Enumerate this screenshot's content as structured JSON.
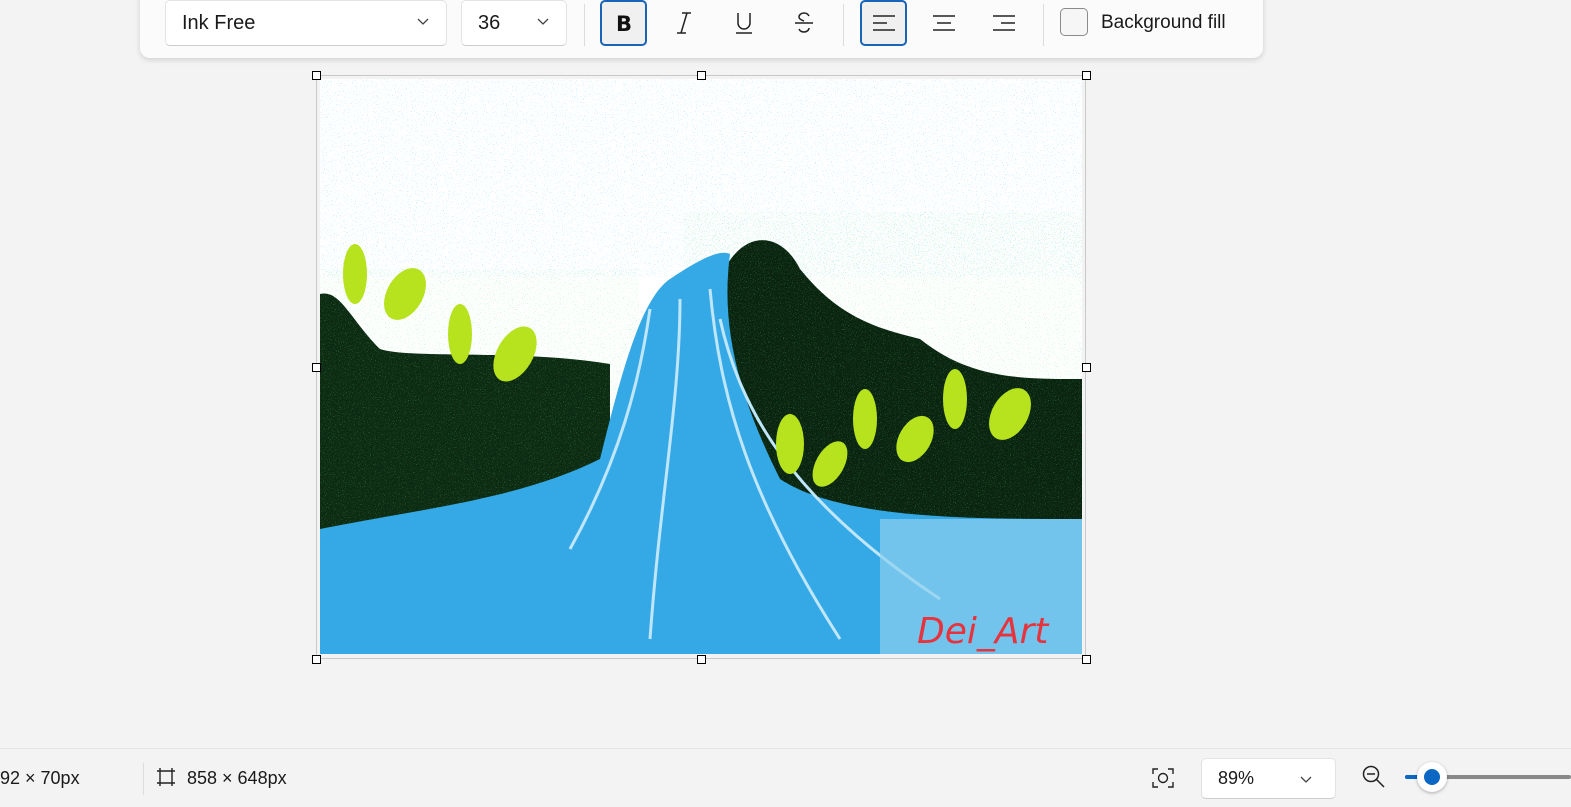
{
  "toolbar": {
    "font_family": "Ink Free",
    "font_size": "36",
    "bold_selected": true,
    "align_selected": "left",
    "background_fill_label": "Background fill",
    "background_fill_checked": false
  },
  "canvas": {
    "signature": "Dei_Art",
    "signature_color": "#e8323c"
  },
  "status": {
    "selection_size": "92 × 70px",
    "canvas_size": "858 × 648px",
    "zoom_value": "89%",
    "zoom_slider_percent": 89
  },
  "colors": {
    "accent": "#1a64b8",
    "slider_accent": "#0a67c3"
  }
}
